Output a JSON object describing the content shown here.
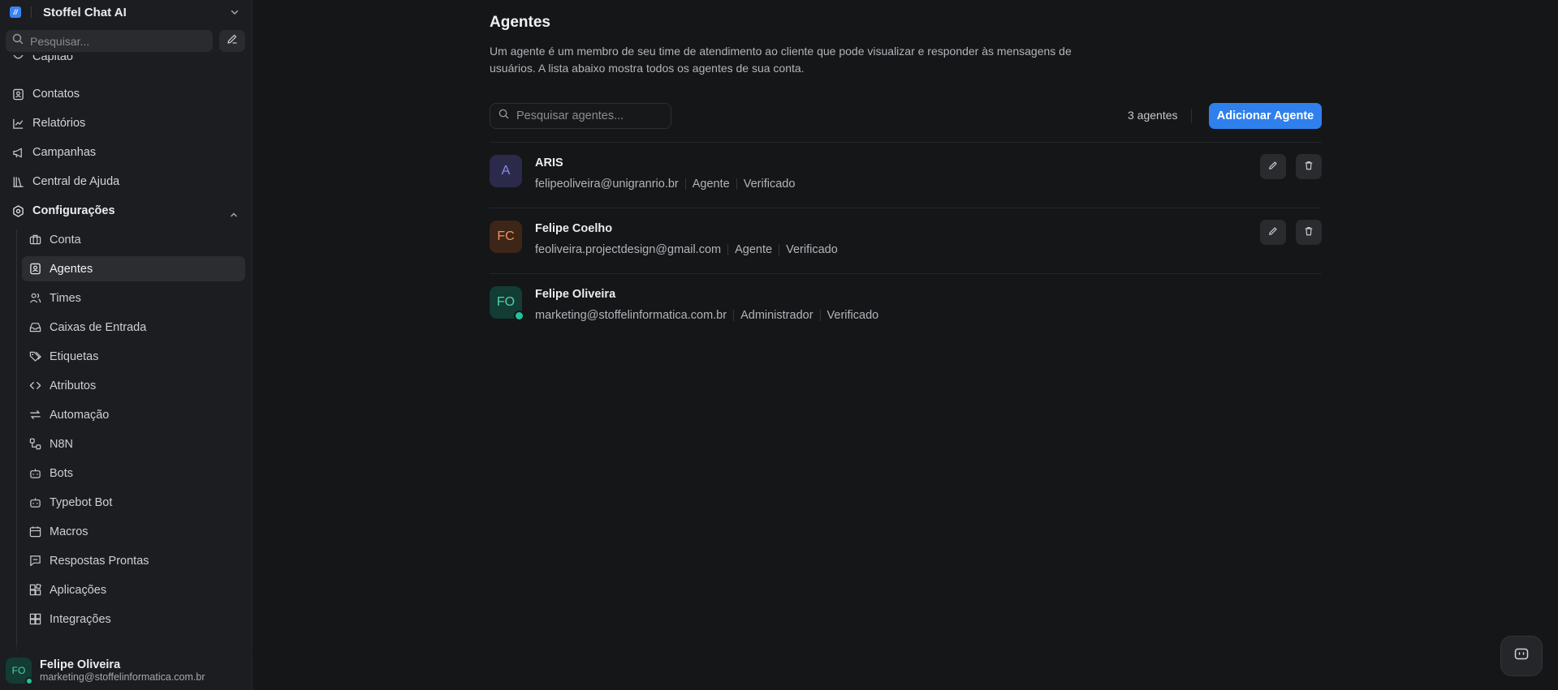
{
  "sidebar": {
    "account_name": "Stoffel Chat AI",
    "search_placeholder": "Pesquisar...",
    "partial_item": "Capitão",
    "nav_items": [
      "Contatos",
      "Relatórios",
      "Campanhas",
      "Central de Ajuda"
    ],
    "config_label": "Configurações",
    "settings_items": [
      "Conta",
      "Agentes",
      "Times",
      "Caixas de Entrada",
      "Etiquetas",
      "Atributos",
      "Automação",
      "N8N",
      "Bots",
      "Typebot Bot",
      "Macros",
      "Respostas Prontas",
      "Aplicações",
      "Integrações"
    ],
    "active_item": "Agentes",
    "user": {
      "initials": "FO",
      "name": "Felipe Oliveira",
      "email": "marketing@stoffelinformatica.com.br"
    }
  },
  "main": {
    "title": "Agentes",
    "description": "Um agente é um membro de seu time de atendimento ao cliente que pode visualizar e responder às mensagens de usuários. A lista abaixo mostra todos os agentes de sua conta.",
    "search_placeholder": "Pesquisar agentes...",
    "count_label": "3 agentes",
    "add_button": "Adicionar Agente",
    "agents": [
      {
        "initials": "A",
        "name": "ARIS",
        "email": "felipeoliveira@unigranrio.br",
        "role": "Agente",
        "status": "Verificado",
        "avatar_bg": "#2b2a4a",
        "avatar_fg": "#8b8ff0"
      },
      {
        "initials": "FC",
        "name": "Felipe Coelho",
        "email": "feoliveira.projectdesign@gmail.com",
        "role": "Agente",
        "status": "Verificado",
        "avatar_bg": "#3d2517",
        "avatar_fg": "#f0925a"
      },
      {
        "initials": "FO",
        "name": "Felipe Oliveira",
        "email": "marketing@stoffelinformatica.com.br",
        "role": "Administrador",
        "status": "Verificado",
        "avatar_bg": "#123c34",
        "avatar_fg": "#4fd1b0"
      }
    ]
  },
  "colors": {
    "accent": "#2f80ed",
    "online": "#22c39a",
    "background": "#151618",
    "sidebar": "#1c1d20"
  }
}
